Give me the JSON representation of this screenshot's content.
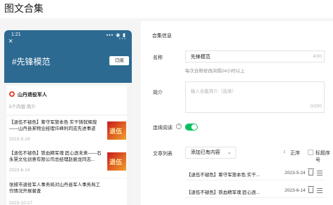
{
  "page": {
    "title": "图文合集"
  },
  "preview": {
    "status_time": "1:21",
    "status_icons": "▪▪▪ ◉ ▮",
    "close_glyph": "×",
    "more_glyph": "···",
    "collection_title": "#先锋模范",
    "subscribe_label": "订阅",
    "header_color": "#2d6a91",
    "author_name": "山丹退役军人",
    "author_meta": "5个内容  简介",
    "articles": [
      {
        "text": "【退伍不褪色】筹守军旅本色 实干铸就辉煌——山丹县某物业经理许峰利同志先进事迹",
        "date": "2023-5-24",
        "thumb_text": "退伍"
      },
      {
        "text": "【退伍不褪色】铁血精军魂 匠心逐未来——石永慧文化创意有限公司总经理赵振龙同志...",
        "date": "2023-6-14",
        "thumb_text": "退伍"
      },
      {
        "text": "张掖市退役军人事务局对山丹县军人事务局工作情况开展督查",
        "date": "2023-10-27"
      }
    ]
  },
  "form": {
    "section_title": "合集信息",
    "name_label": "名称",
    "name_value": "先锋模范",
    "name_count": "4/30",
    "name_hint": "每次合称修改间隔24小时以上",
    "intro_label": "简介",
    "intro_placeholder": "输入合集简介（选填）",
    "intro_count": "0/200",
    "continuous_label": "连续阅读",
    "help_glyph": "?",
    "continuous_enabled": true,
    "accent_color": "#07c160",
    "list_label": "文章列表",
    "add_select_value": "添加已有内容",
    "add_select_chevron": "⌄",
    "sort_glyph": "↕",
    "sort_label": "正序",
    "number_label": "标题序号",
    "items": [
      {
        "title": "【退伍不褪色】筹守军旅本色 实干...",
        "date": "2023-5-24"
      },
      {
        "title": "【退伍不褪色】铁血精军魂 匠心逐...",
        "date": "2023-6-14"
      }
    ]
  }
}
